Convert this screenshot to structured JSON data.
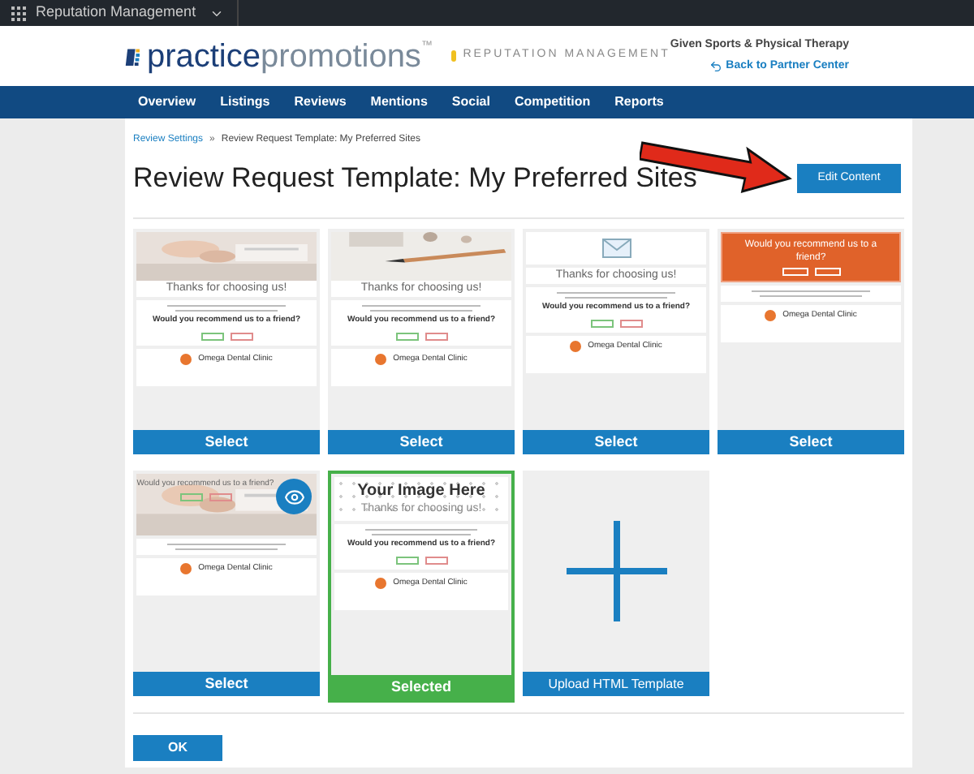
{
  "top_bar": {
    "app": "Reputation Management"
  },
  "header": {
    "brand_main": "practice",
    "brand_accent": "promotions",
    "trademark": "™",
    "product": "REPUTATION MANAGEMENT",
    "account": "Given Sports & Physical Therapy",
    "back_link": "Back to Partner Center"
  },
  "nav": [
    {
      "label": "Overview"
    },
    {
      "label": "Listings"
    },
    {
      "label": "Reviews"
    },
    {
      "label": "Mentions"
    },
    {
      "label": "Social"
    },
    {
      "label": "Competition"
    },
    {
      "label": "Reports"
    }
  ],
  "breadcrumb": [
    {
      "label": "Review Settings",
      "kind": "link"
    },
    {
      "label": "Review Request Template: My Preferred Sites",
      "kind": "current"
    }
  ],
  "separator": "»",
  "title": "Review Request Template: My Preferred Sites",
  "edit_button": "Edit Content",
  "templates": [
    {
      "heading": "Thanks for choosing us!",
      "question": "Would you recommend us to a friend?",
      "clinic": "Omega Dental Clinic",
      "button": "Select",
      "selected": false
    },
    {
      "heading": "Thanks for choosing us!",
      "question": "Would you recommend us to a friend?",
      "clinic": "Omega Dental Clinic",
      "button": "Select",
      "selected": false
    },
    {
      "kind": "envelope",
      "heading": "Thanks for choosing us!",
      "question": "Would you recommend us to a friend?",
      "clinic": "Omega Dental Clinic",
      "button": "Select",
      "selected": false
    },
    {
      "kind": "banner",
      "question": "Would you recommend us to a friend?",
      "clinic": "Omega Dental Clinic",
      "button": "Select",
      "selected": false
    },
    {
      "kind": "overlay",
      "question": "Would you recommend us to a friend?",
      "clinic": "Omega Dental Clinic",
      "button": "Select",
      "selected": false
    },
    {
      "kind": "placeholder",
      "image_label": "Your Image Here",
      "heading": "Thanks for choosing us!",
      "question": "Would you recommend us to a friend?",
      "clinic": "Omega Dental Clinic",
      "button": "Selected",
      "selected": true
    },
    {
      "kind": "upload",
      "button": "Upload HTML Template"
    }
  ],
  "ok_button": "OK"
}
